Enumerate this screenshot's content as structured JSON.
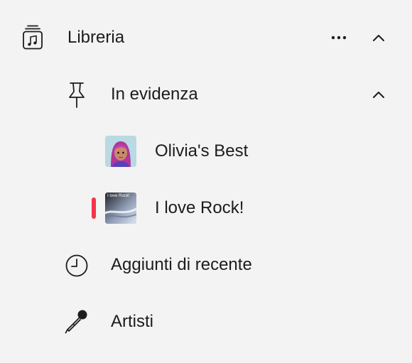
{
  "colors": {
    "background": "#f3f3f3",
    "text": "#1c1c1e",
    "now_playing_indicator": "#f5344a"
  },
  "sidebar": {
    "library": {
      "label": "Libreria",
      "icon": "music-library-icon",
      "more_icon": "ellipsis-icon",
      "collapse_icon": "chevron-up-icon"
    },
    "pinned": {
      "label": "In evidenza",
      "icon": "pin-icon",
      "collapse_icon": "chevron-up-icon",
      "items": [
        {
          "label": "Olivia's Best",
          "artwork": "memoji-artwork"
        },
        {
          "label": "I love Rock!",
          "artwork": "rock-playlist-artwork",
          "artwork_caption": "I love Rock!",
          "now_playing": true
        }
      ]
    },
    "recently_added": {
      "label": "Aggiunti di recente",
      "icon": "clock-icon"
    },
    "artists": {
      "label": "Artisti",
      "icon": "microphone-icon"
    }
  }
}
